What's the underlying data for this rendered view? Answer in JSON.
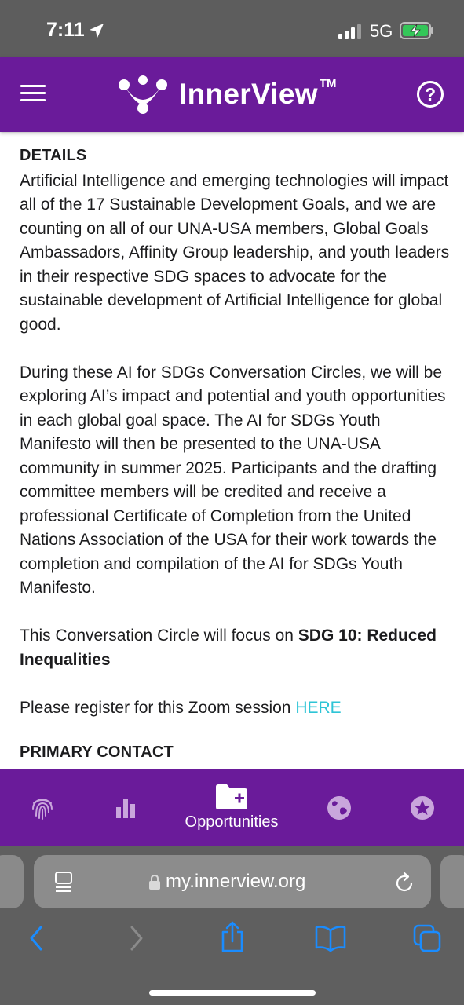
{
  "status_bar": {
    "time": "7:11",
    "network": "5G"
  },
  "header": {
    "brand_name": "InnerView",
    "trademark": "TM",
    "help_symbol": "?"
  },
  "content": {
    "details_heading": "DETAILS",
    "paragraph_1": "Artificial Intelligence and emerging technologies will impact all of the 17 Sustainable Development Goals, and we are counting on all of our UNA-USA members, Global Goals Ambassadors, Affinity Group leadership, and youth leaders in their respective SDG spaces to advocate for the sustainable development of Artificial Intelligence for global good.",
    "paragraph_2": "During these AI for SDGs Conversation Circles, we will be exploring AI’s impact and potential and youth opportunities in each global goal space. The AI for SDGs Youth Manifesto will then be presented to the UNA-USA community in summer 2025. Participants and the drafting committee members will be credited and receive a professional Certificate of Completion from the United Nations Association of the USA for their work towards the completion and compilation of the AI for SDGs Youth Manifesto.",
    "focus_prefix": "This Conversation Circle will focus on ",
    "focus_topic": "SDG 10: Reduced Inequalities",
    "register_prefix": "Please register for this Zoom session ",
    "register_link": "HERE",
    "contact_heading": "PRIMARY CONTACT"
  },
  "tab_bar": {
    "tabs": [
      {
        "icon": "fingerprint-icon",
        "label": ""
      },
      {
        "icon": "bar-chart-icon",
        "label": ""
      },
      {
        "icon": "folder-plus-icon",
        "label": "Opportunities",
        "active": true
      },
      {
        "icon": "globe-icon",
        "label": ""
      },
      {
        "icon": "star-badge-icon",
        "label": ""
      }
    ]
  },
  "browser": {
    "url": "my.innerview.org"
  },
  "colors": {
    "brand_purple": "#6a1b9a",
    "link": "#2ec4d6",
    "status_bar": "#5d5d5d",
    "browser_chrome": "#5f5f5f",
    "nav_icons": "#1a8cff"
  }
}
